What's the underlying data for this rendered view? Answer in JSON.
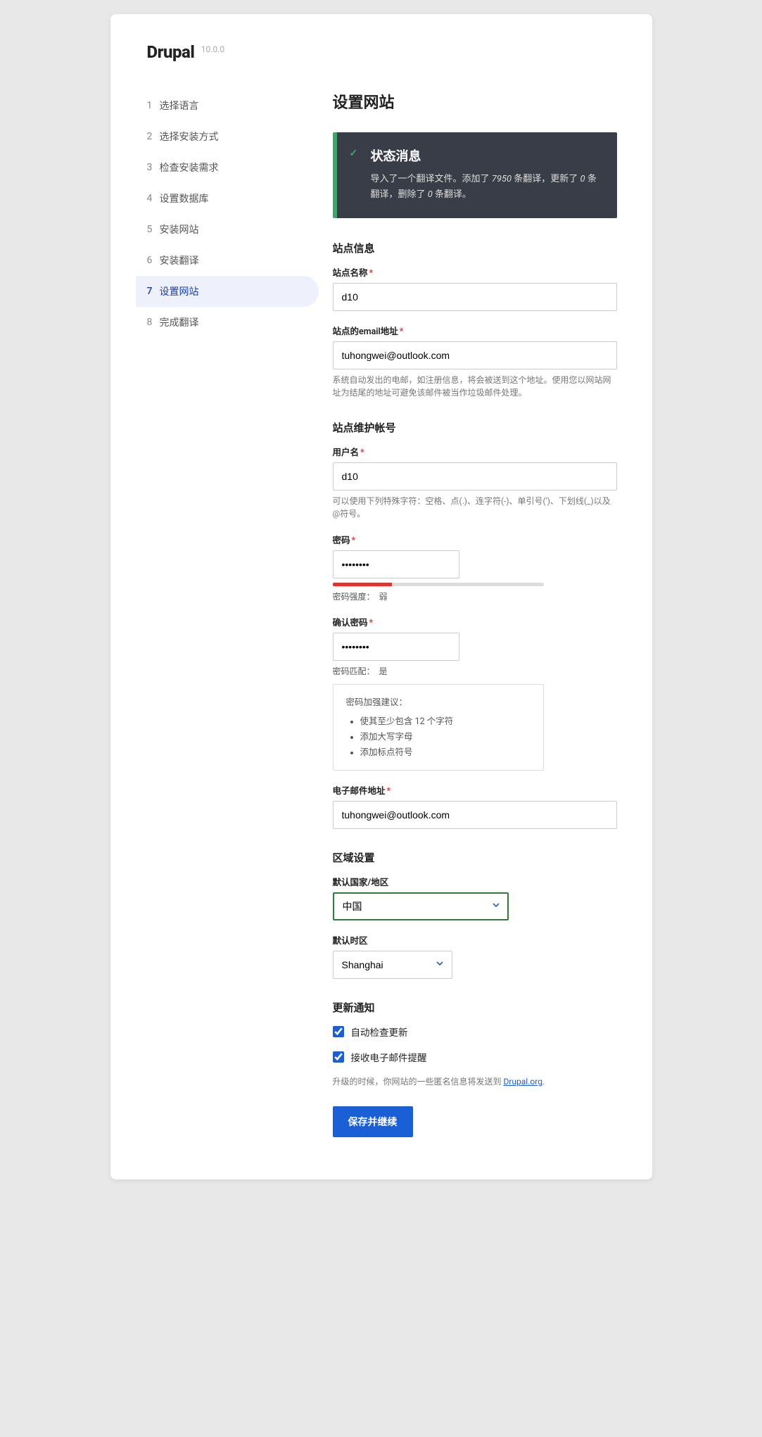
{
  "brand": {
    "name": "Drupal",
    "version": "10.0.0"
  },
  "steps": [
    {
      "num": "1",
      "label": "选择语言"
    },
    {
      "num": "2",
      "label": "选择安装方式"
    },
    {
      "num": "3",
      "label": "检查安装需求"
    },
    {
      "num": "4",
      "label": "设置数据库"
    },
    {
      "num": "5",
      "label": "安装网站"
    },
    {
      "num": "6",
      "label": "安装翻译"
    },
    {
      "num": "7",
      "label": "设置网站"
    },
    {
      "num": "8",
      "label": "完成翻译"
    }
  ],
  "active_step": 7,
  "page_title": "设置网站",
  "status": {
    "title": "状态消息",
    "body_prefix": "导入了一个翻译文件。添加了 ",
    "count1": "7950",
    "mid1": " 条翻译，更新了 ",
    "count2": "0",
    "mid2": " 条翻译，删除了 ",
    "count3": "0",
    "suffix": " 条翻译。"
  },
  "sections": {
    "site_info": "站点信息",
    "maint": "站点维护帐号",
    "region": "区域设置",
    "updates": "更新通知"
  },
  "site_name": {
    "label": "站点名称",
    "value": "d10"
  },
  "site_email": {
    "label": "站点的email地址",
    "value": "tuhongwei@outlook.com",
    "desc": "系统自动发出的电邮，如注册信息，将会被送到这个地址。使用您以网站网址为结尾的地址可避免该邮件被当作垃圾邮件处理。"
  },
  "username": {
    "label": "用户名",
    "value": "d10",
    "desc": "可以使用下列特殊字符：空格、点(.)、连字符(-)、单引号(')、下划线(_)以及@符号。"
  },
  "password": {
    "label": "密码",
    "value": "••••••••",
    "strength_label": "密码强度：",
    "strength_value": "弱"
  },
  "password_confirm": {
    "label": "确认密码",
    "value": "••••••••",
    "match_label": "密码匹配：",
    "match_value": "是"
  },
  "suggestions": {
    "title": "密码加强建议：",
    "items": [
      "使其至少包含 12 个字符",
      "添加大写字母",
      "添加标点符号"
    ]
  },
  "email": {
    "label": "电子邮件地址",
    "value": "tuhongwei@outlook.com"
  },
  "country": {
    "label": "默认国家/地区",
    "value": "中国"
  },
  "timezone": {
    "label": "默认时区",
    "value": "Shanghai"
  },
  "check_updates": {
    "label": "自动检查更新",
    "checked": true
  },
  "email_alerts": {
    "label": "接收电子邮件提醒",
    "checked": true
  },
  "update_note": {
    "prefix": "升级的时候，你网站的一些匿名信息将发送到 ",
    "link": "Drupal.org",
    "suffix": "."
  },
  "submit": "保存并继续"
}
